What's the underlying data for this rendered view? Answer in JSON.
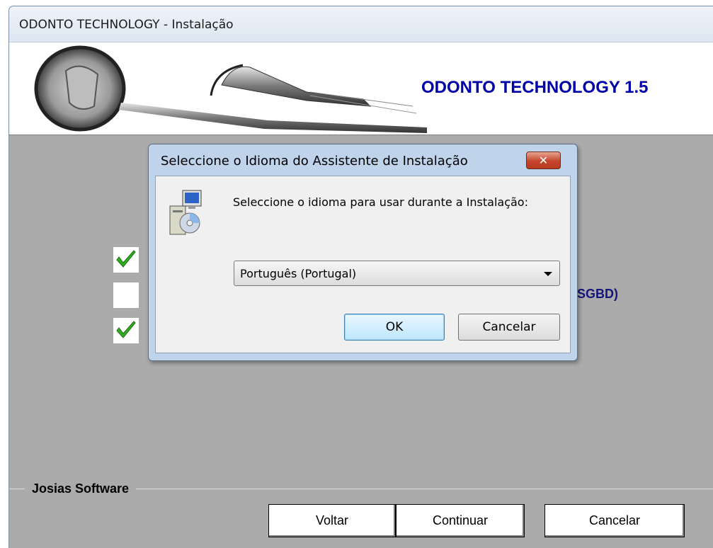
{
  "window": {
    "title": "ODONTO TECHNOLOGY - Instalação",
    "banner_title": "ODONTO TECHNOLOGY 1.5"
  },
  "main": {
    "checkboxes": [
      {
        "checked": true
      },
      {
        "checked": false
      },
      {
        "checked": true
      }
    ],
    "partial_label": "(SGBD)",
    "group_label": "Josias Software",
    "buttons": {
      "back": "Voltar",
      "continue": "Continuar",
      "cancel": "Cancelar"
    }
  },
  "dialog": {
    "title": "Seleccione o Idioma do Assistente de Instalação",
    "message": "Seleccione o idioma para usar durante a Instalação:",
    "language_select": {
      "selected": "Português (Portugal)"
    },
    "ok_label": "OK",
    "cancel_label": "Cancelar"
  },
  "colors": {
    "banner_title": "#0000a8",
    "background": "#ababab",
    "dialog_frame": "#bfd3ea",
    "check_green": "#2fae1f"
  }
}
